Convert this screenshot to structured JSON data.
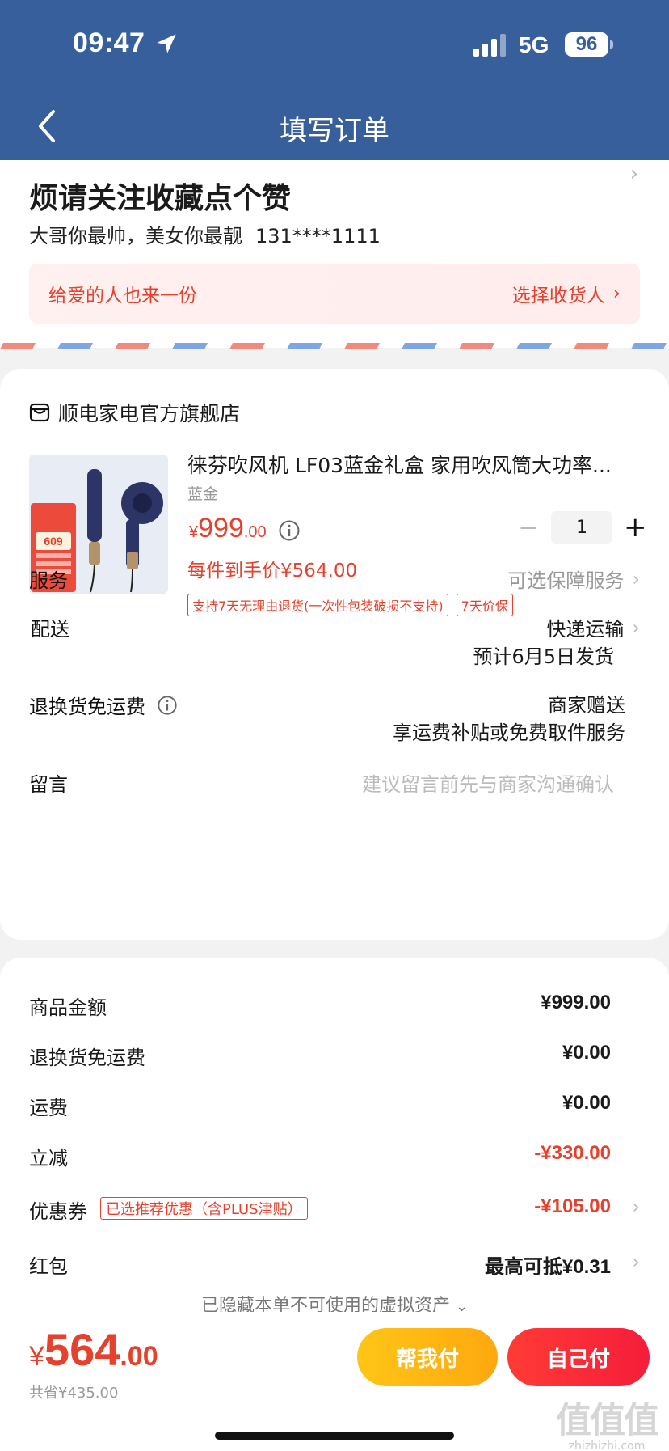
{
  "status_bar": {
    "time": "09:47",
    "network": "5G",
    "battery": "96"
  },
  "nav": {
    "title": "填写订单"
  },
  "address": {
    "name": "烦请关注收藏点个赞",
    "detail": "大哥你最帅，美女你最靓",
    "phone": "131****1111",
    "gift_text": "给爱的人也来一份",
    "gift_action": "选择收货人"
  },
  "shop": {
    "name": "顺电家电官方旗舰店"
  },
  "product": {
    "title": "徕芬吹风机 LF03蓝金礼盒 家用吹风筒大功率...",
    "spec": "蓝金",
    "price_currency": "¥",
    "price_int": "999",
    "price_dec": ".00",
    "unit_price": "每件到手价¥564.00",
    "quantity": "1",
    "tags": [
      "支持7天无理由退货(一次性包装破损不支持)",
      "7天价保"
    ],
    "thumb_badge_price": "609"
  },
  "service": {
    "label": "服务",
    "value": "可选保障服务"
  },
  "delivery": {
    "label": "配送",
    "value": "快递运输",
    "eta": "预计6月5日发货"
  },
  "return_shipping": {
    "label": "退换货免运费",
    "value": "商家赠送",
    "sub": "享运费补贴或免费取件服务"
  },
  "message": {
    "label": "留言",
    "placeholder": "建议留言前先与商家沟通确认"
  },
  "summary": {
    "goods_label": "商品金额",
    "goods_value": "¥999.00",
    "return_label": "退换货免运费",
    "return_value": "¥0.00",
    "freight_label": "运费",
    "freight_value": "¥0.00",
    "discount_label": "立减",
    "discount_value": "-¥330.00",
    "coupon_label": "优惠券",
    "coupon_tag": "已选推荐优惠（含PLUS津贴）",
    "coupon_value": "-¥105.00",
    "redpacket_label": "红包",
    "redpacket_value": "最高可抵¥0.31",
    "hidden_assets": "已隐藏本单不可使用的虚拟资产"
  },
  "bottom": {
    "total_currency": "¥",
    "total_int": "564",
    "total_dec": ".00",
    "saved": "共省¥435.00",
    "help_pay": "帮我付",
    "self_pay": "自己付"
  },
  "watermark": {
    "big": "值值值",
    "small": "zhizhizhi.com"
  },
  "colors": {
    "header_bg": "#365f9b",
    "accent_red": "#e5412d",
    "help_btn": "#ffb814",
    "self_btn": "#f5263a"
  }
}
